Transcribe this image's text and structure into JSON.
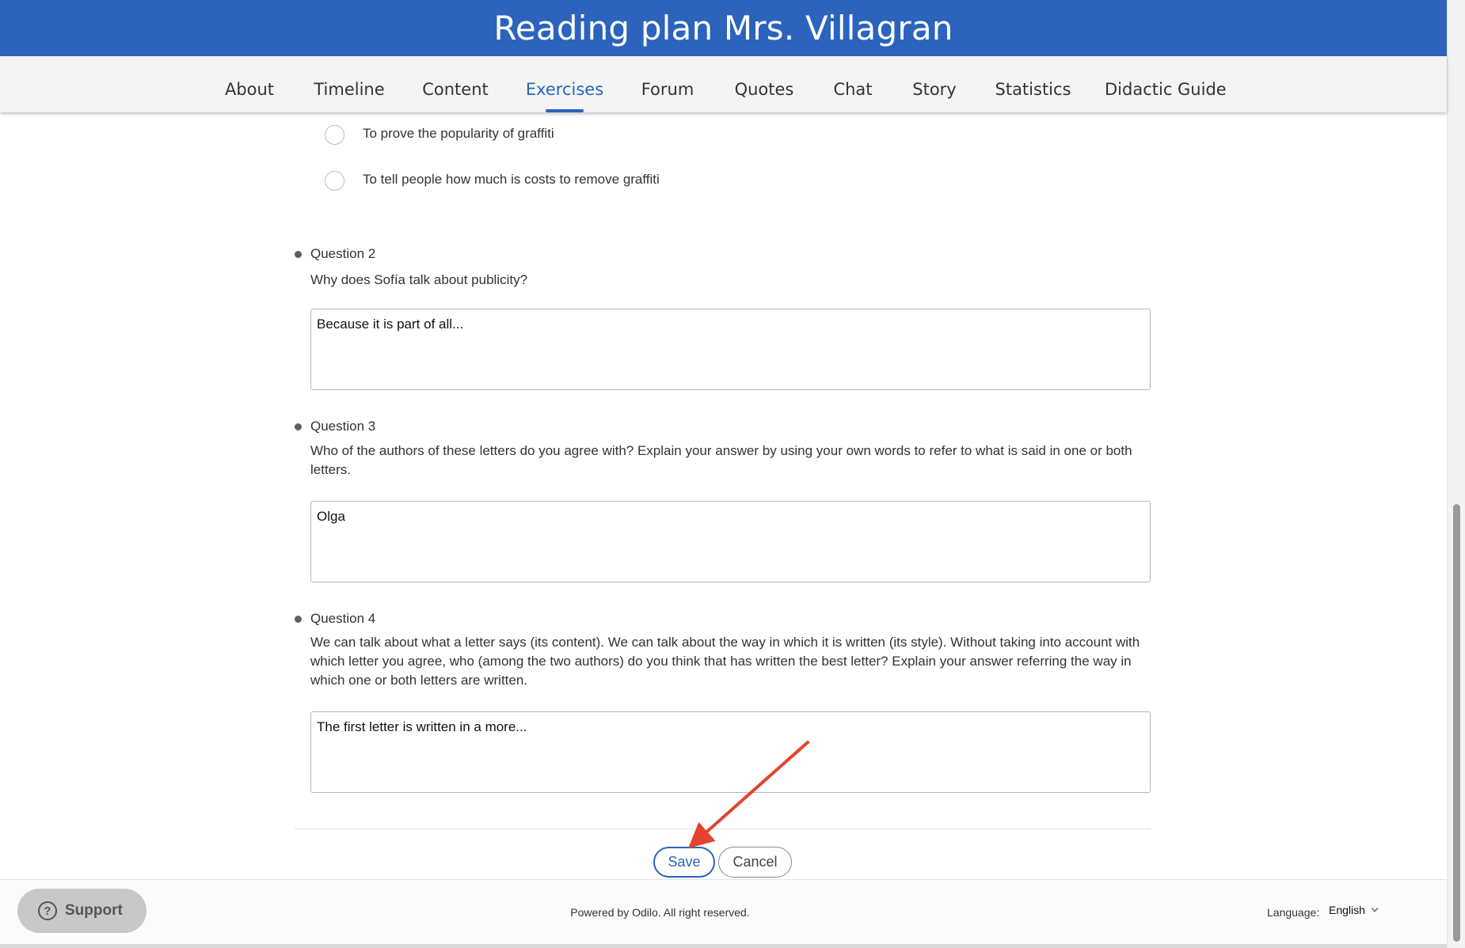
{
  "header": {
    "title": "Reading plan Mrs. Villagran"
  },
  "nav": {
    "items": [
      {
        "label": "About"
      },
      {
        "label": "Timeline"
      },
      {
        "label": "Content"
      },
      {
        "label": "Exercises",
        "active": true
      },
      {
        "label": "Forum"
      },
      {
        "label": "Quotes"
      },
      {
        "label": "Chat"
      },
      {
        "label": "Story"
      },
      {
        "label": "Statistics"
      },
      {
        "label": "Didactic Guide"
      }
    ]
  },
  "question1": {
    "options": [
      {
        "label": "To prove the popularity of graffiti",
        "selected": false
      },
      {
        "label": "To tell people how much is costs to remove graffiti",
        "selected": false
      }
    ]
  },
  "questions": [
    {
      "title": "Question 2",
      "text": "Why does Sofía talk about publicity?",
      "answer": "Because it is part of all..."
    },
    {
      "title": "Question 3",
      "text": "Who of the authors of these letters do you agree with? Explain your answer by using your own words to refer to what is said in one or both letters.",
      "answer": "Olga"
    },
    {
      "title": "Question 4",
      "text": "We can talk about what a letter says (its content). We can talk about the way in which it is written (its style). Without taking into account with which letter you agree, who (among the two authors) do you think that has written the best letter? Explain your answer referring the way in which one or both letters are written.",
      "answer": "The first letter is written in a more..."
    }
  ],
  "actions": {
    "save_label": "Save",
    "cancel_label": "Cancel"
  },
  "footer": {
    "support_label": "Support",
    "support_icon": "?",
    "powered_by": "Powered by Odilo. All right reserved.",
    "language_label": "Language:",
    "language_value": "English"
  },
  "colors": {
    "brand": "#2b63bd",
    "annotation_arrow": "#e4432d"
  },
  "icons": {
    "support": "question-circle-icon",
    "language_dropdown": "chevron-down-icon"
  }
}
